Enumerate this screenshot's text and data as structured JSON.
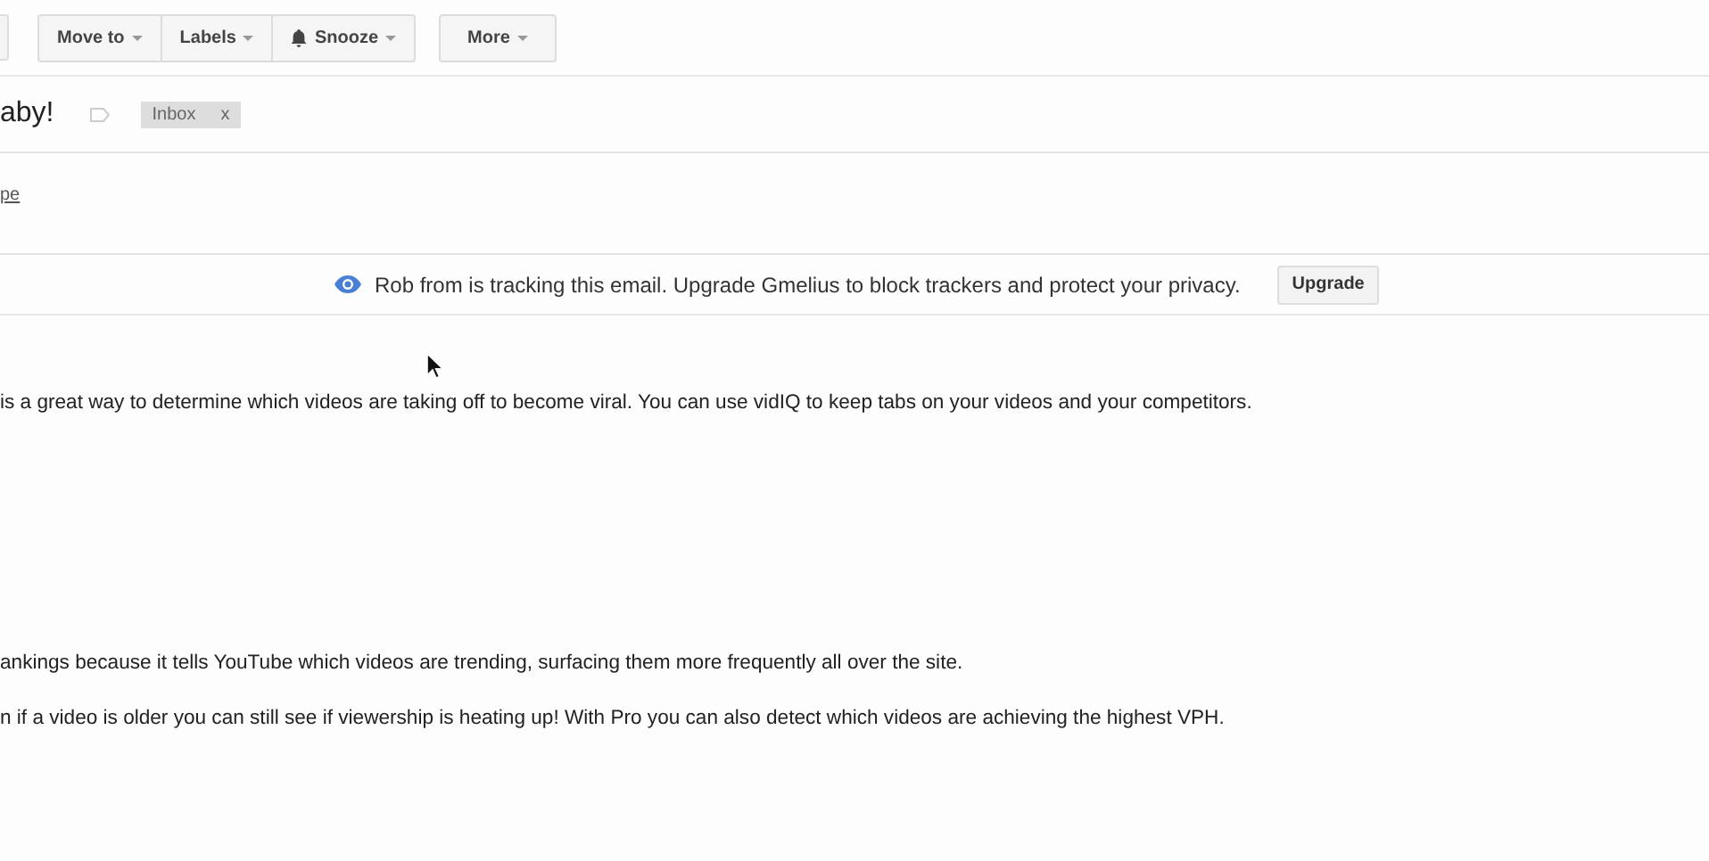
{
  "toolbar": {
    "groups": [
      [
        {
          "label": "Move to",
          "kind": "dropdown"
        },
        {
          "label": "Labels",
          "kind": "dropdown"
        },
        {
          "label": "Snooze",
          "kind": "reminder"
        }
      ],
      [
        {
          "label": "More",
          "kind": "dropdown"
        }
      ]
    ]
  },
  "subject": {
    "text": "aby!",
    "label_tag": {
      "text": "Inbox",
      "remove": "x"
    }
  },
  "sender_link": "pe",
  "tracking_banner": {
    "message": "Rob from is tracking this email. Upgrade Gmelius to block trackers and protect your privacy.",
    "button": "Upgrade"
  },
  "body": [
    "is a great way to determine which videos are taking off to become viral. You can use vidIQ to keep tabs on your videos and your competitors.",
    "ankings because it tells YouTube which videos are trending, surfacing them more frequently all over the site.",
    "n if a video is older you can still see if viewership is heating up! With Pro you can also detect which videos are achieving the highest VPH."
  ]
}
